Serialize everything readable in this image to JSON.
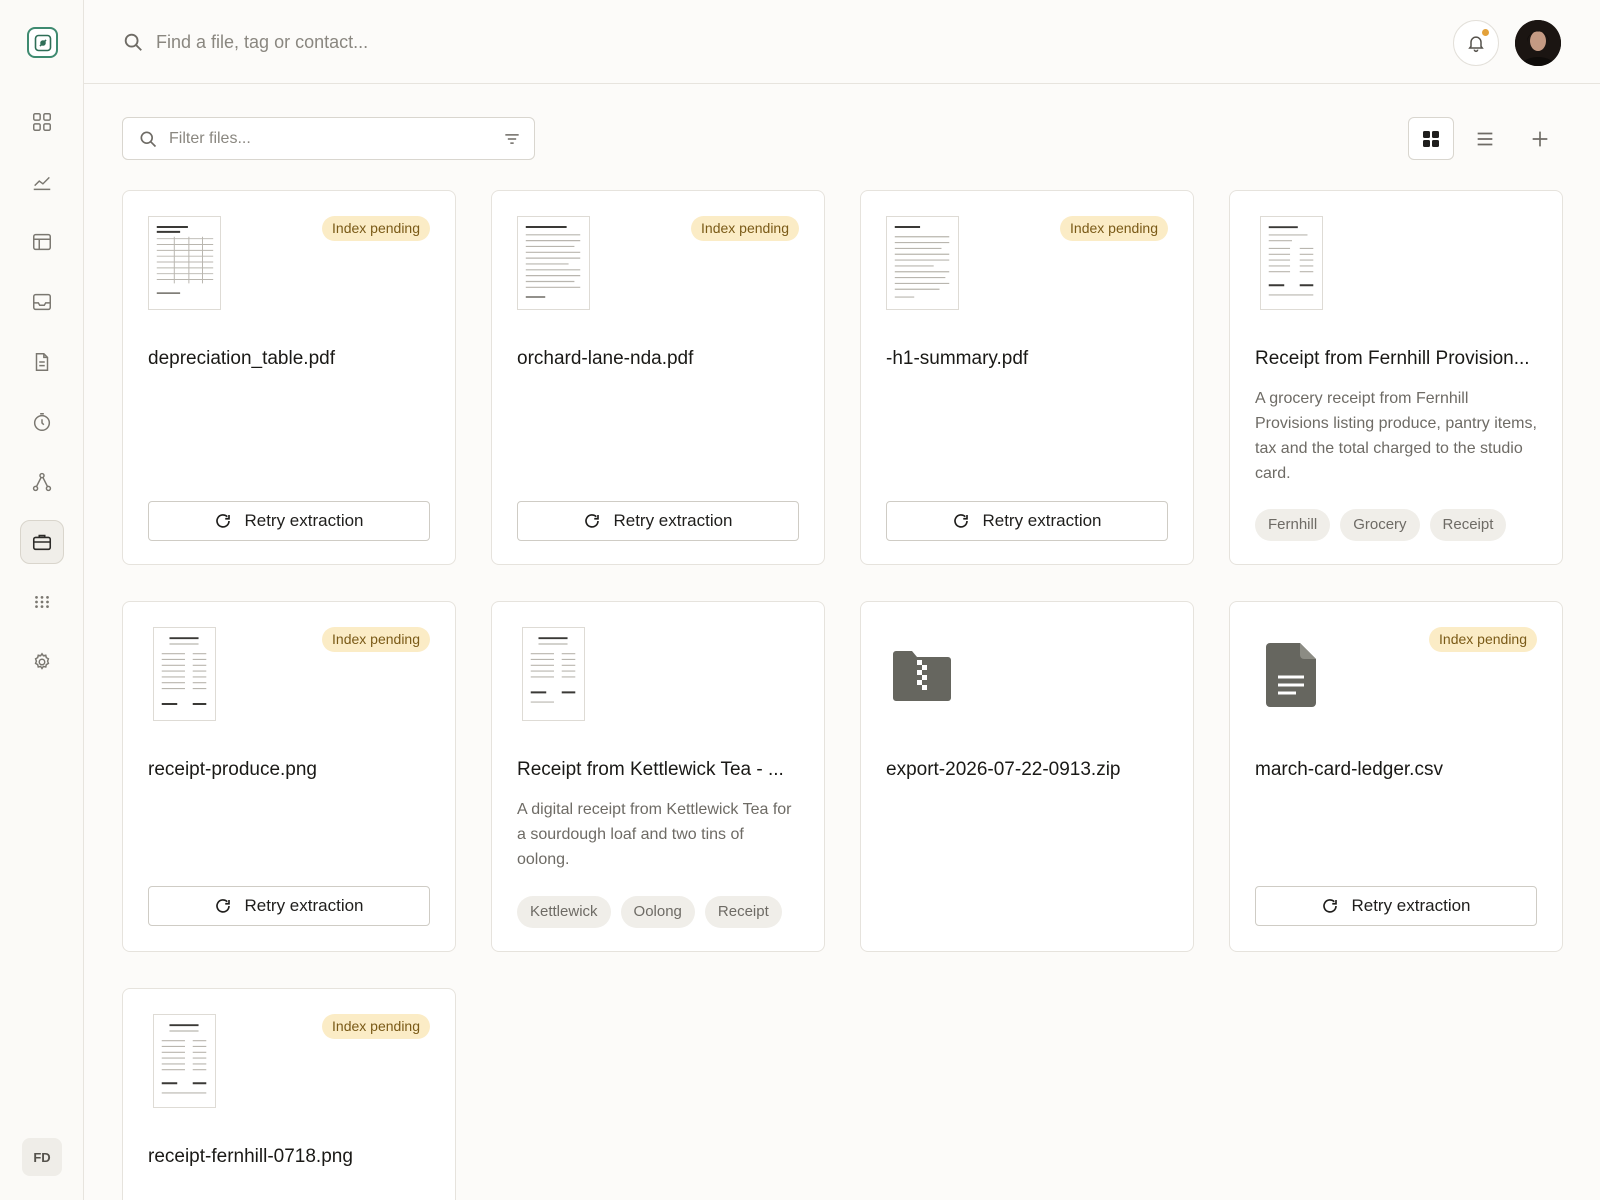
{
  "sidebar": {
    "logo": "compass-logo",
    "items": [
      {
        "icon": "grid-icon"
      },
      {
        "icon": "chart-line-icon"
      },
      {
        "icon": "layout-icon"
      },
      {
        "icon": "inbox-icon"
      },
      {
        "icon": "document-icon"
      },
      {
        "icon": "timer-icon"
      },
      {
        "icon": "network-icon"
      },
      {
        "icon": "briefcase-icon",
        "active": true
      },
      {
        "icon": "apps-icon"
      },
      {
        "icon": "gear-icon"
      }
    ],
    "user_initials": "FD"
  },
  "topbar": {
    "search_placeholder": "Find a file, tag or contact..."
  },
  "toolbar": {
    "filter_placeholder": "Filter files...",
    "active_view": "grid"
  },
  "colors": {
    "accent": "#3e8a70",
    "badge_bg": "#fbecc6",
    "badge_text": "#7a5a17"
  },
  "cards": [
    {
      "title": "depreciation_table.pdf",
      "badge": "Index pending",
      "retry": "Retry extraction",
      "thumb": "table"
    },
    {
      "title": "orchard-lane-nda.pdf",
      "badge": "Index pending",
      "retry": "Retry extraction",
      "thumb": "text"
    },
    {
      "title": "-h1-summary.pdf",
      "badge": "Index pending",
      "retry": "Retry extraction",
      "thumb": "text"
    },
    {
      "title": "Receipt from Fernhill Provision...",
      "desc": "A grocery receipt from Fernhill Provisions listing produce, pantry items, tax and the total charged to the studio card.",
      "tags": [
        "Fernhill",
        "Grocery",
        "Receipt"
      ],
      "thumb": "receipt"
    },
    {
      "title": "receipt-produce.png",
      "badge": "Index pending",
      "retry": "Retry extraction",
      "thumb": "receipt"
    },
    {
      "title": "Receipt from Kettlewick Tea - ...",
      "desc": "A digital receipt from Kettlewick Tea for a sourdough loaf and two tins of oolong.",
      "tags": [
        "Kettlewick",
        "Oolong",
        "Receipt"
      ],
      "thumb": "receipt"
    },
    {
      "title": "export-2026-07-22-0913.zip",
      "icon": "zip-folder-icon"
    },
    {
      "title": "march-card-ledger.csv",
      "badge": "Index pending",
      "retry": "Retry extraction",
      "icon": "csv-file-icon"
    },
    {
      "title": "receipt-fernhill-0718.png",
      "badge": "Index pending",
      "thumb": "receipt"
    }
  ]
}
